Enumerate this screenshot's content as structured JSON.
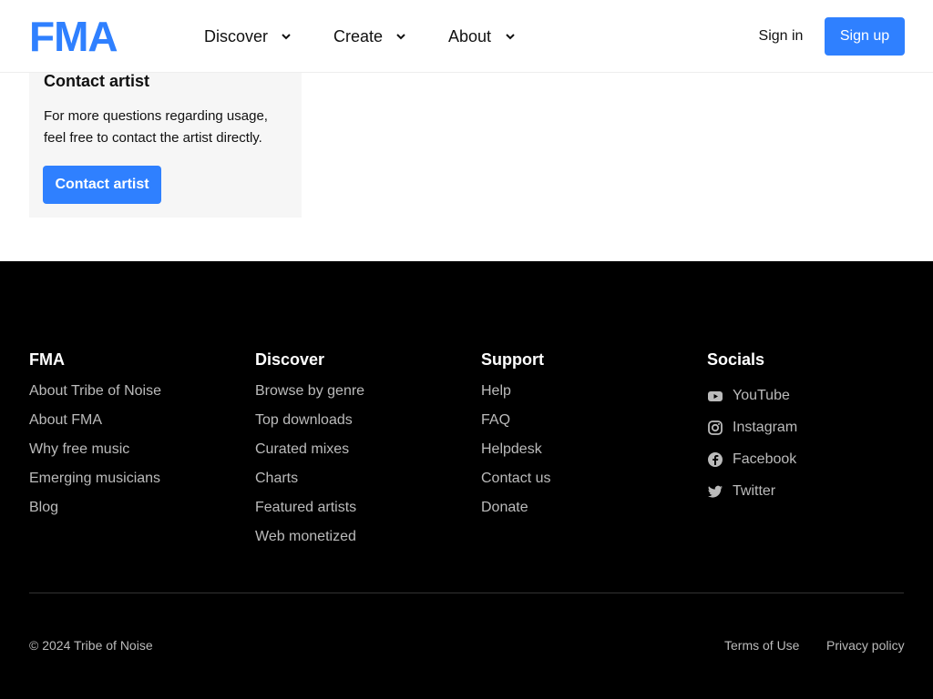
{
  "header": {
    "logo_text": "FMA",
    "nav": [
      {
        "label": "Discover"
      },
      {
        "label": "Create"
      },
      {
        "label": "About"
      }
    ],
    "sign_in": "Sign in",
    "sign_up": "Sign up"
  },
  "contact": {
    "title": "Contact artist",
    "text": "For more questions regarding usage, feel free to contact the artist directly.",
    "button": "Contact artist"
  },
  "footer": {
    "columns": [
      {
        "title": "FMA",
        "links": [
          "About Tribe of Noise",
          "About FMA",
          "Why free music",
          "Emerging musicians",
          "Blog"
        ]
      },
      {
        "title": "Discover",
        "links": [
          "Browse by genre",
          "Top downloads",
          "Curated mixes",
          "Charts",
          "Featured artists",
          "Web monetized"
        ]
      },
      {
        "title": "Support",
        "links": [
          "Help",
          "FAQ",
          "Helpdesk",
          "Contact us",
          "Donate"
        ]
      },
      {
        "title": "Socials",
        "links": [
          "YouTube",
          "Instagram",
          "Facebook",
          "Twitter"
        ]
      }
    ],
    "copyright": "© 2024 Tribe of Noise",
    "terms": "Terms of Use",
    "privacy": "Privacy policy"
  },
  "colors": {
    "accent": "#2f80ff",
    "footer_bg": "#000000"
  },
  "icons": {
    "nav_chevron": "chevron-down-icon",
    "socials": [
      "youtube-icon",
      "instagram-icon",
      "facebook-icon",
      "twitter-icon"
    ]
  }
}
